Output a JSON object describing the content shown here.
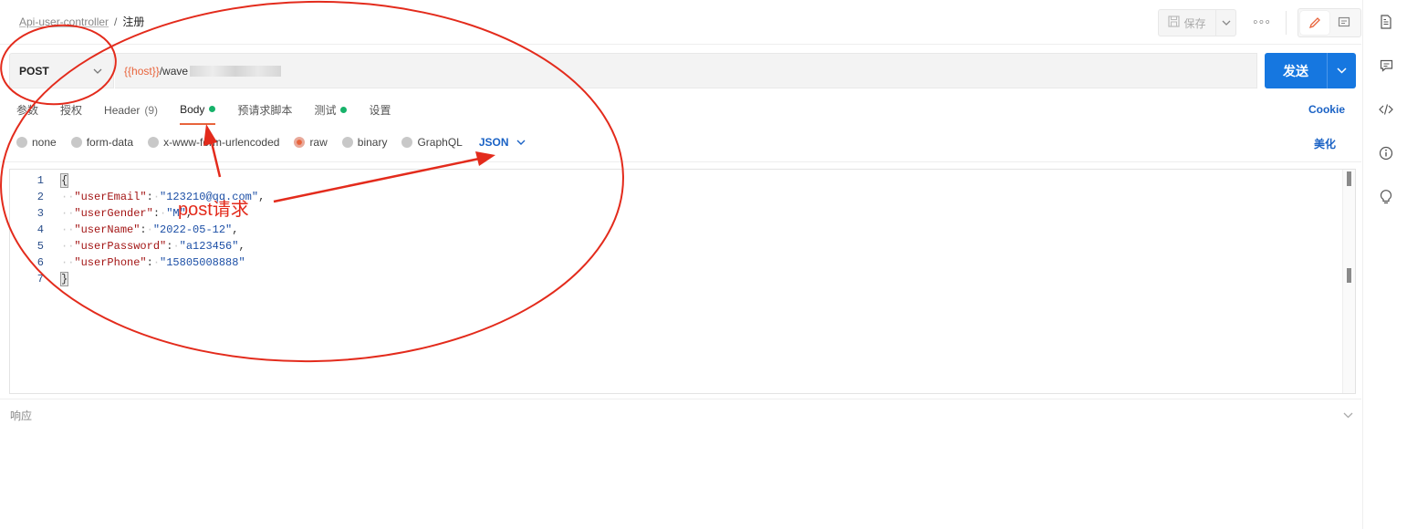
{
  "breadcrumb": {
    "parent": "Api-user-controller",
    "separator": "/",
    "current": "注册"
  },
  "toolbar": {
    "save_label": "保存",
    "more_label": "◦◦◦"
  },
  "request": {
    "method": "POST",
    "url_var": "{{host}}",
    "url_rest": "/wave",
    "send_label": "发送"
  },
  "tabs": [
    {
      "label": "参数"
    },
    {
      "label": "授权"
    },
    {
      "label": "Header",
      "count": "(9)"
    },
    {
      "label": "Body",
      "active": true,
      "dot": true
    },
    {
      "label": "预请求脚本"
    },
    {
      "label": "测试",
      "dot": true
    },
    {
      "label": "设置"
    }
  ],
  "cookie_label": "Cookie",
  "body_types": [
    {
      "label": "none",
      "selected": false
    },
    {
      "label": "form-data",
      "selected": false
    },
    {
      "label": "x-www-form-urlencoded",
      "selected": false
    },
    {
      "label": "raw",
      "selected": true
    },
    {
      "label": "binary",
      "selected": false
    },
    {
      "label": "GraphQL",
      "selected": false
    }
  ],
  "raw_format": "JSON",
  "beautify_label": "美化",
  "editor": {
    "line_numbers": [
      "1",
      "2",
      "3",
      "4",
      "5",
      "6",
      "7"
    ],
    "lines": [
      {
        "brace": "{"
      },
      {
        "key": "\"userEmail\"",
        "value": "\"123210@qq.com\"",
        "comma": ","
      },
      {
        "key": "\"userGender\"",
        "value": "\"M\"",
        "comma": ","
      },
      {
        "key": "\"userName\"",
        "value": "\"2022-05-12\"",
        "comma": ","
      },
      {
        "key": "\"userPassword\"",
        "value": "\"a123456\"",
        "comma": ","
      },
      {
        "key": "\"userPhone\"",
        "value": "\"15805008888\"",
        "comma": ""
      },
      {
        "brace": "}"
      }
    ]
  },
  "response_label": "响应",
  "annotation": {
    "text": "post请求",
    "color": "#e32b1c"
  },
  "colors": {
    "accent": "#e8643c",
    "primary": "#1677e0",
    "link": "#1a62c5",
    "success": "#17b26a"
  },
  "rail_icons": [
    "document-icon",
    "comment-icon",
    "code-icon",
    "info-icon",
    "bulb-icon"
  ]
}
